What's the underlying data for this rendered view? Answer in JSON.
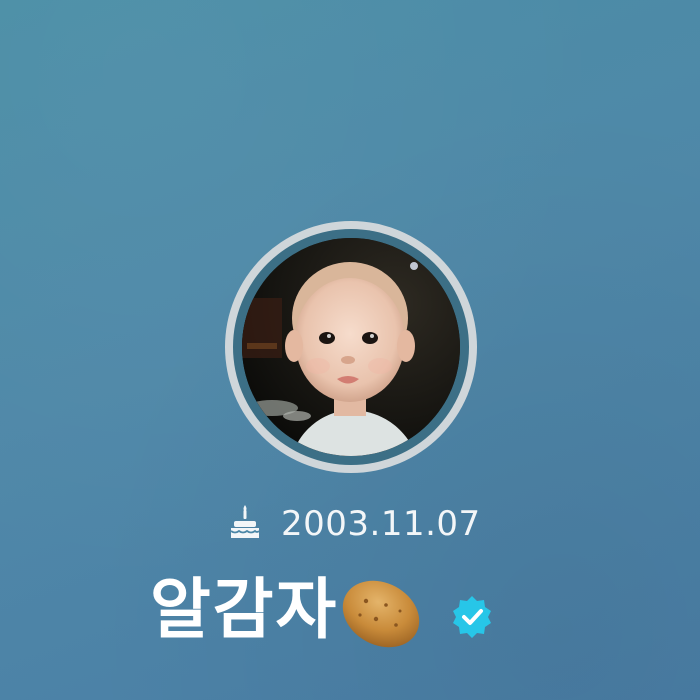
{
  "profile": {
    "birthday": "2003.11.07",
    "name": "알감자",
    "icons": {
      "birthday": "cake-icon",
      "name_emoji": "potato-icon",
      "badge": "verified-badge-icon"
    }
  },
  "colors": {
    "background": "#4b87a7",
    "avatar_ring": "#cfd6da",
    "text": "#ffffff",
    "verified_badge": "#27c6e8"
  }
}
